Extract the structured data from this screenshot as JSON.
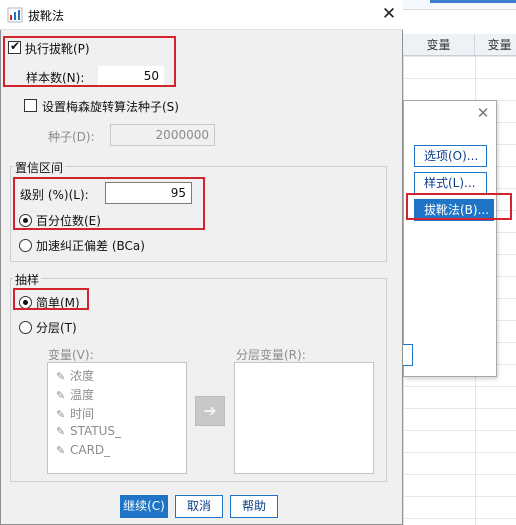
{
  "background": {
    "columns": [
      "变量",
      "变量"
    ],
    "panel_buttons": [
      {
        "label": "选项(O)..."
      },
      {
        "label": "样式(L)..."
      },
      {
        "label": "拔靴法(B)..."
      }
    ]
  },
  "dialog": {
    "title": "拔靴法",
    "perform_bootstrap": {
      "label": "执行拔靴(P)",
      "checked": true
    },
    "samples": {
      "label": "样本数(N):",
      "value": "50"
    },
    "mersenne": {
      "label": "设置梅森旋转算法种子(S)",
      "checked": false
    },
    "seed": {
      "label": "种子(D):",
      "value": "2000000"
    },
    "ci_group": {
      "title": "置信区间",
      "level_label": "级别 (%)(L):",
      "level_value": "95",
      "percentile_label": "百分位数(E)",
      "bca_label": "加速纠正偏差 (BCa)"
    },
    "sampling_group": {
      "title": "抽样",
      "simple_label": "简单(M)",
      "stratified_label": "分层(T)",
      "variables_label": "变量(V):",
      "strata_label": "分层变量(R):",
      "variables": [
        "浓度",
        "温度",
        "时间",
        "STATUS_",
        "CARD_"
      ]
    },
    "buttons": {
      "continue": "继续(C)",
      "cancel": "取消",
      "help": "帮助"
    }
  },
  "colors": {
    "accent": "#1f74c7",
    "highlight_box": "#d3232c",
    "dialog_bg": "#f0f0f0"
  }
}
